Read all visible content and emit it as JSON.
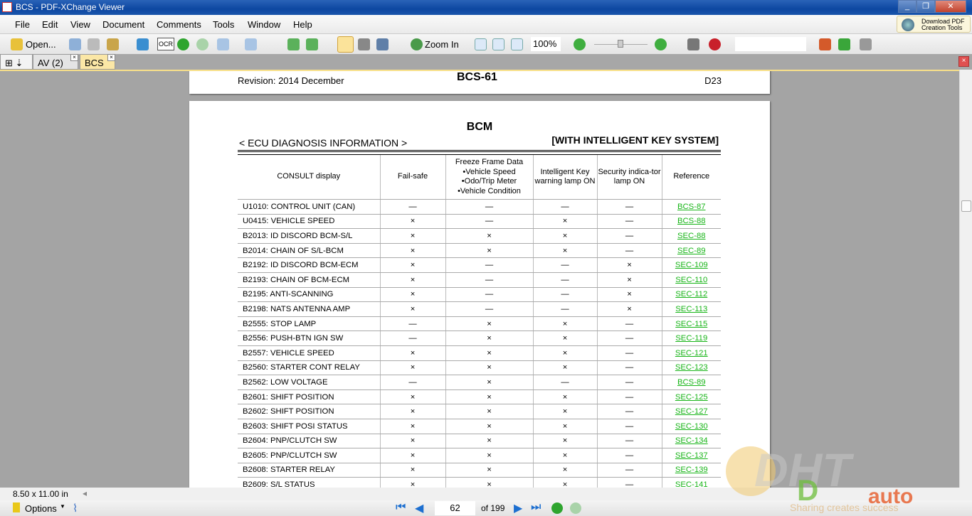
{
  "window": {
    "title": "BCS - PDF-XChange Viewer"
  },
  "menu": [
    "File",
    "Edit",
    "View",
    "Document",
    "Comments",
    "Tools",
    "Window",
    "Help"
  ],
  "download_tools": "Download PDF Creation Tools",
  "toolbar": {
    "open_label": "Open...",
    "ocr_label": "OCR",
    "zoom_in_label": "Zoom In",
    "zoom_value": "100%",
    "zoom_slider_percent": 50,
    "search_value": ""
  },
  "tabs": [
    {
      "label": "AV (2)",
      "active": false
    },
    {
      "label": "BCS",
      "active": true
    }
  ],
  "page_prev": {
    "revision": "Revision: 2014 December",
    "page_code": "BCS-61",
    "right_code": "D23"
  },
  "page": {
    "title": "BCM",
    "section_left": "< ECU DIAGNOSIS INFORMATION >",
    "section_right": "[WITH INTELLIGENT KEY SYSTEM]",
    "headers": [
      "CONSULT display",
      "Fail-safe",
      "Freeze Frame Data\n•Vehicle Speed\n•Odo/Trip Meter\n•Vehicle Condition",
      "Intelligent Key warning lamp ON",
      "Security indica-tor lamp ON",
      "Reference"
    ],
    "rows": [
      [
        "U1010: CONTROL UNIT (CAN)",
        "—",
        "—",
        "—",
        "—",
        "BCS-87"
      ],
      [
        "U0415: VEHICLE SPEED",
        "×",
        "—",
        "×",
        "—",
        "BCS-88"
      ],
      [
        "B2013: ID DISCORD BCM-S/L",
        "×",
        "×",
        "×",
        "—",
        "SEC-88"
      ],
      [
        "B2014: CHAIN OF S/L-BCM",
        "×",
        "×",
        "×",
        "—",
        "SEC-89"
      ],
      [
        "B2192: ID DISCORD BCM-ECM",
        "×",
        "—",
        "—",
        "×",
        "SEC-109"
      ],
      [
        "B2193: CHAIN OF BCM-ECM",
        "×",
        "—",
        "—",
        "×",
        "SEC-110"
      ],
      [
        "B2195: ANTI-SCANNING",
        "×",
        "—",
        "—",
        "×",
        "SEC-112"
      ],
      [
        "B2198: NATS ANTENNA AMP",
        "×",
        "—",
        "—",
        "×",
        "SEC-113"
      ],
      [
        "B2555: STOP LAMP",
        "—",
        "×",
        "×",
        "—",
        "SEC-115"
      ],
      [
        "B2556: PUSH-BTN IGN SW",
        "—",
        "×",
        "×",
        "—",
        "SEC-119"
      ],
      [
        "B2557: VEHICLE SPEED",
        "×",
        "×",
        "×",
        "—",
        "SEC-121"
      ],
      [
        "B2560: STARTER CONT RELAY",
        "×",
        "×",
        "×",
        "—",
        "SEC-123"
      ],
      [
        "B2562: LOW VOLTAGE",
        "—",
        "×",
        "—",
        "—",
        "BCS-89"
      ],
      [
        "B2601: SHIFT POSITION",
        "×",
        "×",
        "×",
        "—",
        "SEC-125"
      ],
      [
        "B2602: SHIFT POSITION",
        "×",
        "×",
        "×",
        "—",
        "SEC-127"
      ],
      [
        "B2603: SHIFT POSI STATUS",
        "×",
        "×",
        "×",
        "—",
        "SEC-130"
      ],
      [
        "B2604: PNP/CLUTCH SW",
        "×",
        "×",
        "×",
        "—",
        "SEC-134"
      ],
      [
        "B2605: PNP/CLUTCH SW",
        "×",
        "×",
        "×",
        "—",
        "SEC-137"
      ],
      [
        "B2608: STARTER RELAY",
        "×",
        "×",
        "×",
        "—",
        "SEC-139"
      ],
      [
        "B2609: S/L STATUS",
        "×",
        "×",
        "×",
        "—",
        "SEC-141"
      ]
    ]
  },
  "status": {
    "page_size": "8.50 x 11.00 in"
  },
  "bottom": {
    "options_label": "Options",
    "current_page": "62",
    "page_total": "of 199"
  },
  "watermark": {
    "logo": "DHT auto",
    "tagline": "Sharing creates success"
  },
  "colors": {
    "link": "#18b518",
    "titlebar": "#0d47a1"
  }
}
